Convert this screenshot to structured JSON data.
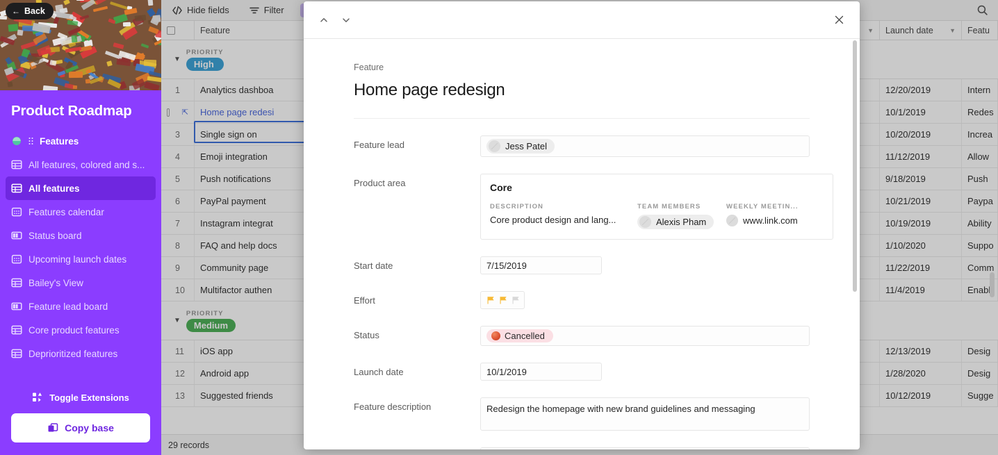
{
  "sidebar": {
    "back_label": "Back",
    "base_title": "Product Roadmap",
    "table_name": "Features",
    "views": [
      {
        "label": "All features, colored and s...",
        "icon": "grid-icon",
        "active": false
      },
      {
        "label": "All features",
        "icon": "grid-icon",
        "active": true
      },
      {
        "label": "Features calendar",
        "icon": "calendar-icon",
        "active": false
      },
      {
        "label": "Status board",
        "icon": "kanban-icon",
        "active": false
      },
      {
        "label": "Upcoming launch dates",
        "icon": "calendar-icon",
        "active": false
      },
      {
        "label": "Bailey's View",
        "icon": "grid-icon",
        "active": false
      },
      {
        "label": "Feature lead board",
        "icon": "kanban-icon",
        "active": false
      },
      {
        "label": "Core product features",
        "icon": "grid-icon",
        "active": false
      },
      {
        "label": "Deprioritized features",
        "icon": "grid-icon",
        "active": false
      }
    ],
    "toggle_extensions_label": "Toggle Extensions",
    "copy_base_label": "Copy base",
    "accent": "#8b3dff",
    "active_bg": "#6f27e0"
  },
  "toolbar": {
    "hide_fields_label": "Hide fields",
    "filter_label": "Filter",
    "search_icon": "search-icon"
  },
  "grid": {
    "columns": [
      "Feature",
      "Launch date",
      "Featu"
    ],
    "record_count_label": "29 records",
    "groups": [
      {
        "kicker": "PRIORITY",
        "value": "High",
        "color": "#2d9bd4",
        "rows": [
          {
            "num": "1",
            "feature": "Analytics dashboa",
            "launch": "12/20/2019",
            "last": "Intern",
            "selected": false,
            "has_status_dot": false
          },
          {
            "num": "2",
            "feature": "Home page redesi",
            "launch": "10/1/2019",
            "last": "Redes",
            "selected": true,
            "has_status_dot": false
          },
          {
            "num": "3",
            "feature": "Single sign on",
            "launch": "10/20/2019",
            "last": "Increa",
            "selected": false,
            "has_status_dot": false
          },
          {
            "num": "4",
            "feature": "Emoji integration",
            "launch": "11/12/2019",
            "last": "Allow",
            "selected": false,
            "has_status_dot": false
          },
          {
            "num": "5",
            "feature": "Push notifications",
            "launch": "9/18/2019",
            "last": "Push",
            "selected": false,
            "has_status_dot": false
          },
          {
            "num": "6",
            "feature": "PayPal payment",
            "launch": "10/21/2019",
            "last": "Paypa",
            "selected": false,
            "has_status_dot": false
          },
          {
            "num": "7",
            "feature": "Instagram integrat",
            "launch": "10/19/2019",
            "last": "Ability",
            "selected": false,
            "has_status_dot": false
          },
          {
            "num": "8",
            "feature": "FAQ and help docs",
            "launch": "1/10/2020",
            "last": "Suppo",
            "selected": false,
            "has_status_dot": false
          },
          {
            "num": "9",
            "feature": "Community page",
            "launch": "11/22/2019",
            "last": "Comm",
            "selected": false,
            "has_status_dot": true
          },
          {
            "num": "10",
            "feature": "Multifactor authen",
            "launch": "11/4/2019",
            "last": "Enabl",
            "selected": false,
            "has_status_dot": false
          }
        ]
      },
      {
        "kicker": "PRIORITY",
        "value": "Medium",
        "color": "#3fa94a",
        "rows": [
          {
            "num": "11",
            "feature": "iOS app",
            "launch": "12/13/2019",
            "last": "Desig",
            "selected": false,
            "has_status_dot": false
          },
          {
            "num": "12",
            "feature": "Android app",
            "launch": "1/28/2020",
            "last": "Desig",
            "selected": false,
            "has_status_dot": true
          },
          {
            "num": "13",
            "feature": "Suggested friends",
            "launch": "10/12/2019",
            "last": "Sugge",
            "selected": false,
            "has_status_dot": false
          }
        ]
      }
    ]
  },
  "modal": {
    "prev_icon": "chevron-up-icon",
    "next_icon": "chevron-down-icon",
    "close_icon": "close-icon",
    "record_kicker": "Feature",
    "record_title": "Home page redesign",
    "fields": {
      "feature_lead": {
        "label": "Feature lead",
        "value": "Jess Patel"
      },
      "product_area": {
        "label": "Product area",
        "title": "Core",
        "description_kicker": "DESCRIPTION",
        "description_value": "Core product design and lang...",
        "team_kicker": "TEAM MEMBERS",
        "team_value": "Alexis Pham",
        "meeting_kicker": "WEEKLY MEETIN...",
        "meeting_value": "www.link.com"
      },
      "start_date": {
        "label": "Start date",
        "value": "7/15/2019"
      },
      "effort": {
        "label": "Effort",
        "filled": 2,
        "total": 3,
        "color": "#f7b934",
        "empty_color": "#d8d8d8"
      },
      "status": {
        "label": "Status",
        "value": "Cancelled",
        "pill_bg": "#fbdfe4",
        "dot_color": "#e05434"
      },
      "launch_date": {
        "label": "Launch date",
        "value": "10/1/2019"
      },
      "description": {
        "label": "Feature description",
        "value": "Redesign the homepage with new brand guidelines and messaging"
      }
    }
  }
}
